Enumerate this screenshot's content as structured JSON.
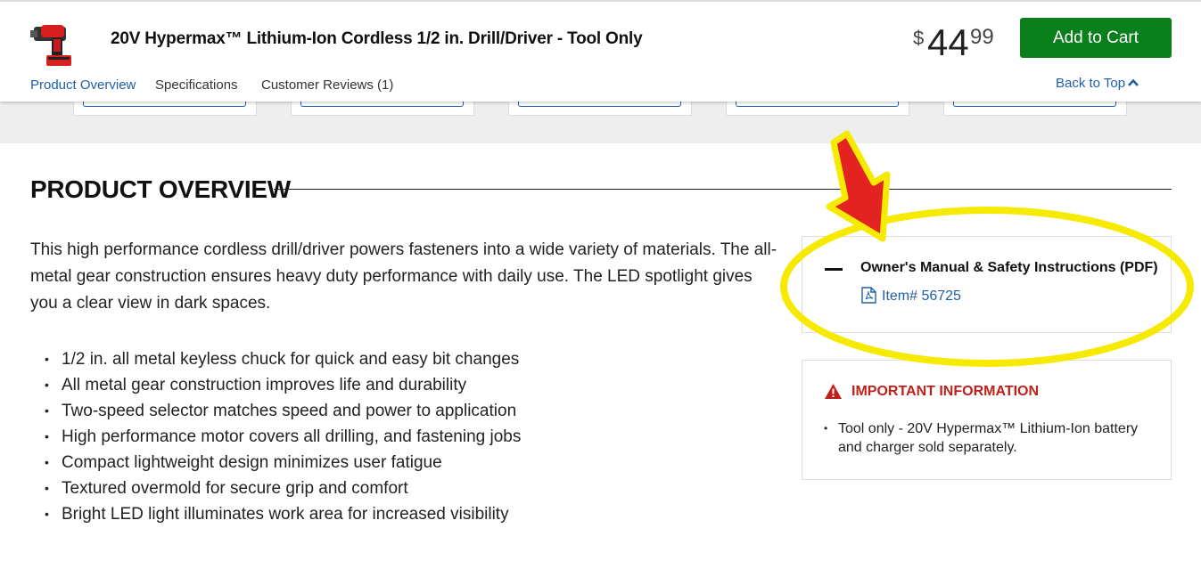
{
  "header": {
    "product_title": "20V Hypermax™ Lithium-Ion Cordless 1/2 in. Drill/Driver - Tool Only",
    "price": {
      "currency": "$",
      "dollars": "44",
      "cents": "99"
    },
    "add_to_cart_label": "Add to Cart",
    "tabs": [
      {
        "label": "Product Overview",
        "active": true
      },
      {
        "label": "Specifications",
        "active": false
      },
      {
        "label": "Customer Reviews (1)",
        "active": false
      }
    ],
    "back_to_top_label": "Back to Top",
    "back_to_top_icon": "chevron-up-icon",
    "thumbnail_icon": "drill-product-thumbnail"
  },
  "overview": {
    "title": "PRODUCT OVERVIEW",
    "description": "This high performance cordless drill/driver powers fasteners into a wide variety of materials. The all-metal gear construction ensures heavy duty performance with daily use. The LED spotlight gives you a clear view in dark spaces.",
    "features": [
      "1/2 in. all metal keyless chuck for quick and easy bit changes",
      "All metal gear construction improves life and durability",
      "Two-speed selector matches speed and power to application",
      "High performance motor covers all drilling, and fastening jobs",
      "Compact lightweight design minimizes user fatigue",
      "Textured overmold for secure grip and comfort",
      "Bright LED light illuminates work area for increased visibility"
    ]
  },
  "manuals": {
    "title": "Owner's Manual & Safety Instructions (PDF)",
    "collapse_icon": "minus-icon",
    "link_icon": "pdf-icon",
    "link_label": "Item# 56725"
  },
  "important": {
    "icon": "warning-icon",
    "title": "IMPORTANT INFORMATION",
    "items": [
      "Tool only - 20V Hypermax™ Lithium-Ion battery and charger sold separately."
    ]
  },
  "annotation": {
    "arrow_color": "#e32222",
    "arrow_outline_color": "#f5ea00",
    "ellipse_color": "#f5ea00"
  },
  "colors": {
    "link_blue": "#1f5fa8",
    "cart_green": "#0a7f1c",
    "warning_red": "#c0201a",
    "band_gray": "#eeeeee"
  }
}
